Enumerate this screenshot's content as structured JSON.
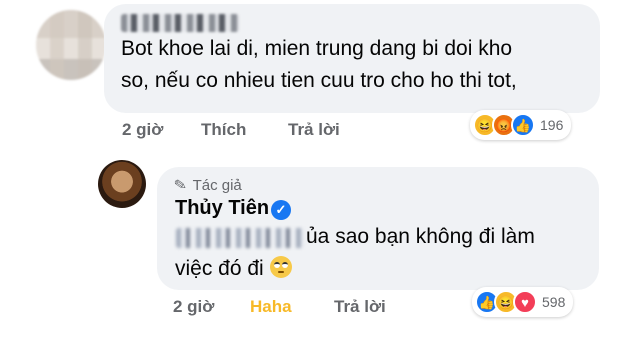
{
  "comment1": {
    "line1": "Bot khoe lai di, mien trung dang bi doi kho",
    "line2": "so, nếu co nhieu tien cuu tro cho ho thi tot,",
    "time": "2 giờ",
    "like_label": "Thích",
    "reply_label": "Trả lời",
    "reaction_icons": [
      "haha-icon",
      "angry-icon",
      "like-icon"
    ],
    "reaction_count": "196"
  },
  "comment2": {
    "author_badge": "Tác giả",
    "author_name": "Thủy Tiên",
    "line1": "ủa sao bạn không đi làm",
    "line2": "việc đó đi",
    "time": "2 giờ",
    "reaction_label": "Haha",
    "reply_label": "Trả lời",
    "reaction_icons": [
      "like-icon",
      "haha-icon",
      "love-icon"
    ],
    "reaction_count": "598"
  },
  "colors": {
    "bubble": "#f0f2f5",
    "meta": "#65676b",
    "haha_accent": "#f7b928",
    "verified": "#1877f2"
  }
}
